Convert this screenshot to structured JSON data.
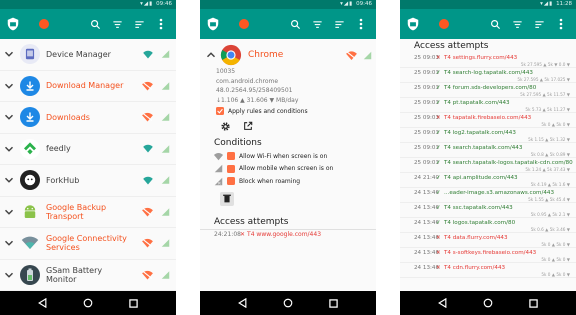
{
  "status_times": [
    "09:46",
    "09:46",
    "11:28"
  ],
  "phone1": {
    "rows": [
      {
        "label": "Device Manager",
        "style": "gray",
        "icon": "device-manager-icon"
      },
      {
        "label": "Download Manager",
        "style": "orange",
        "icon": "download-icon"
      },
      {
        "label": "Downloads",
        "style": "orange",
        "icon": "download-icon"
      },
      {
        "label": "feedly",
        "style": "gray",
        "icon": "feedly-icon"
      },
      {
        "label": "ForkHub",
        "style": "gray",
        "icon": "forkhub-icon"
      },
      {
        "label": "Google Backup Transport",
        "style": "orange",
        "icon": "android-icon"
      },
      {
        "label": "Google Connectivity Services",
        "style": "orange",
        "icon": "connectivity-icon"
      },
      {
        "label": "GSam Battery Monitor",
        "style": "gray",
        "icon": "battery-icon"
      }
    ]
  },
  "phone2": {
    "app_name": "Chrome",
    "uid": "10035",
    "package": "com.android.chrome",
    "version": "48.0.2564.95/258409501",
    "traffic": "↓1.106 ▲ 31.606 ▼ MB/day",
    "apply_rules": "Apply rules and conditions",
    "conditions_title": "Conditions",
    "conditions": [
      {
        "label": "Allow Wi-Fi when screen is on",
        "icon": "wifi-icon"
      },
      {
        "label": "Allow mobile when screen is on",
        "icon": "signal-icon"
      },
      {
        "label": "Block when roaming",
        "icon": "roaming-icon"
      }
    ],
    "attempts_title": "Access attempts",
    "attempt": {
      "time": "24:21:08",
      "mark": "✕",
      "host": "T4 www.google.com/443"
    }
  },
  "phone3": {
    "title": "Access attempts",
    "rows": [
      {
        "time": "25 09:03",
        "mark": "✕",
        "host": "T4 settings.flurry.com/443",
        "bad": true,
        "meta": "5k 27.595 ▲ 5k ▼ 0.0 ▼"
      },
      {
        "time": "25 09:03",
        "mark": "✓",
        "host": "T4 search-log.tapatalk.com/443",
        "bad": false,
        "meta": "5k 27.595 ▲ 5k 17.025 ▼"
      },
      {
        "time": "25 09:03",
        "mark": "✓",
        "host": "T4 forum.sds-developers.com/80",
        "bad": false,
        "meta": "5k 27.595 ▲ 5k 11.57 ▼"
      },
      {
        "time": "25 09:03",
        "mark": "✓",
        "host": "T4 pt.tapatalk.com/443",
        "bad": false,
        "meta": "5k 5.73 ▲ 5k 11.27 ▼"
      },
      {
        "time": "25 09:03",
        "mark": "✕",
        "host": "T4 tapatalk.firebaseio.com/443",
        "bad": true,
        "meta": "5k 0 ▲ 5k 0 ▼"
      },
      {
        "time": "25 09:03",
        "mark": "✓",
        "host": "T4 log2.tapatalk.com/443",
        "bad": false,
        "meta": "5k 1.15 ▲ 5k 1.32 ▼"
      },
      {
        "time": "25 09:03",
        "mark": "✓",
        "host": "T4 search.tapatalk.com/443",
        "bad": false,
        "meta": "5k 0.8 ▲ 5k 0.89 ▼"
      },
      {
        "time": "25 09:03",
        "mark": "✓",
        "host": "T4 search.tapatalk-logos.tapatalk-cdn.com/80",
        "bad": false,
        "meta": "5k 1.24 ▲ 5k 37.43 ▼"
      },
      {
        "time": "24 21:40",
        "mark": "✓",
        "host": "T4 api.amplitude.com/443",
        "bad": false,
        "meta": "5k 4.19 ▲ 5k 1.6 ▼"
      },
      {
        "time": "24 13:46",
        "mark": "✓",
        "host": "...eader-image.s3.amazonaws.com/443",
        "bad": false,
        "meta": "5k 1.55 ▲ 5k 45.4 ▼"
      },
      {
        "time": "24 13:46",
        "mark": "✓",
        "host": "T4 ssc.tapatalk.com/443",
        "bad": false,
        "meta": "5k 0.95 ▲ 5k 2.1 ▼"
      },
      {
        "time": "24 13:46",
        "mark": "✓",
        "host": "T4 logos.tapatalk.com/80",
        "bad": false,
        "meta": "5k 0.6 ▲ 5k 3.46 ▼"
      },
      {
        "time": "24 13:46",
        "mark": "✕",
        "host": "T4 data.flurry.com/443",
        "bad": true,
        "meta": "5k 0 ▲ 5k 0 ▼"
      },
      {
        "time": "24 13:46",
        "mark": "✕",
        "host": "T4 s-softkeys.firebaseio.com/443",
        "bad": true,
        "meta": "5k 0 ▲ 5k 0 ▼"
      },
      {
        "time": "24 13:46",
        "mark": "✕",
        "host": "T4 cdn.flurry.com/443",
        "bad": true,
        "meta": "5k 0 ▲ 5k 0 ▼"
      }
    ]
  },
  "colors": {
    "primary": "#009688",
    "primary_dark": "#00796b",
    "accent": "#ff5722",
    "orange_text": "#f4511e"
  }
}
